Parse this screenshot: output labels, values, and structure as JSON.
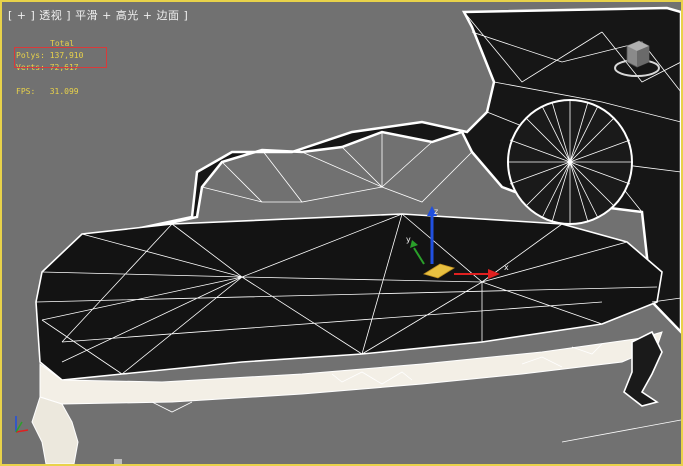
{
  "viewport": {
    "label": "[ + ] 透视 ] 平滑 + 高光 + 边面 ]",
    "border_color": "#e8d24a"
  },
  "stats": {
    "title": "Total",
    "polys": "Polys: 137,910",
    "verts": "Verts: 72,617",
    "fps": "FPS:   31.099"
  },
  "gizmo": {
    "x_label": "x",
    "y_label": "y",
    "z_label": "z"
  },
  "colors": {
    "stats_text": "#e8d24a",
    "highlight": "#d83a3a",
    "axis_x": "#e02020",
    "axis_y": "#2aa02a",
    "axis_z": "#2050e0",
    "gizmo_plane": "#e8c040"
  },
  "icons": [
    "viewcube-icon",
    "transform-gizmo-icon",
    "axis-tripod-icon"
  ]
}
